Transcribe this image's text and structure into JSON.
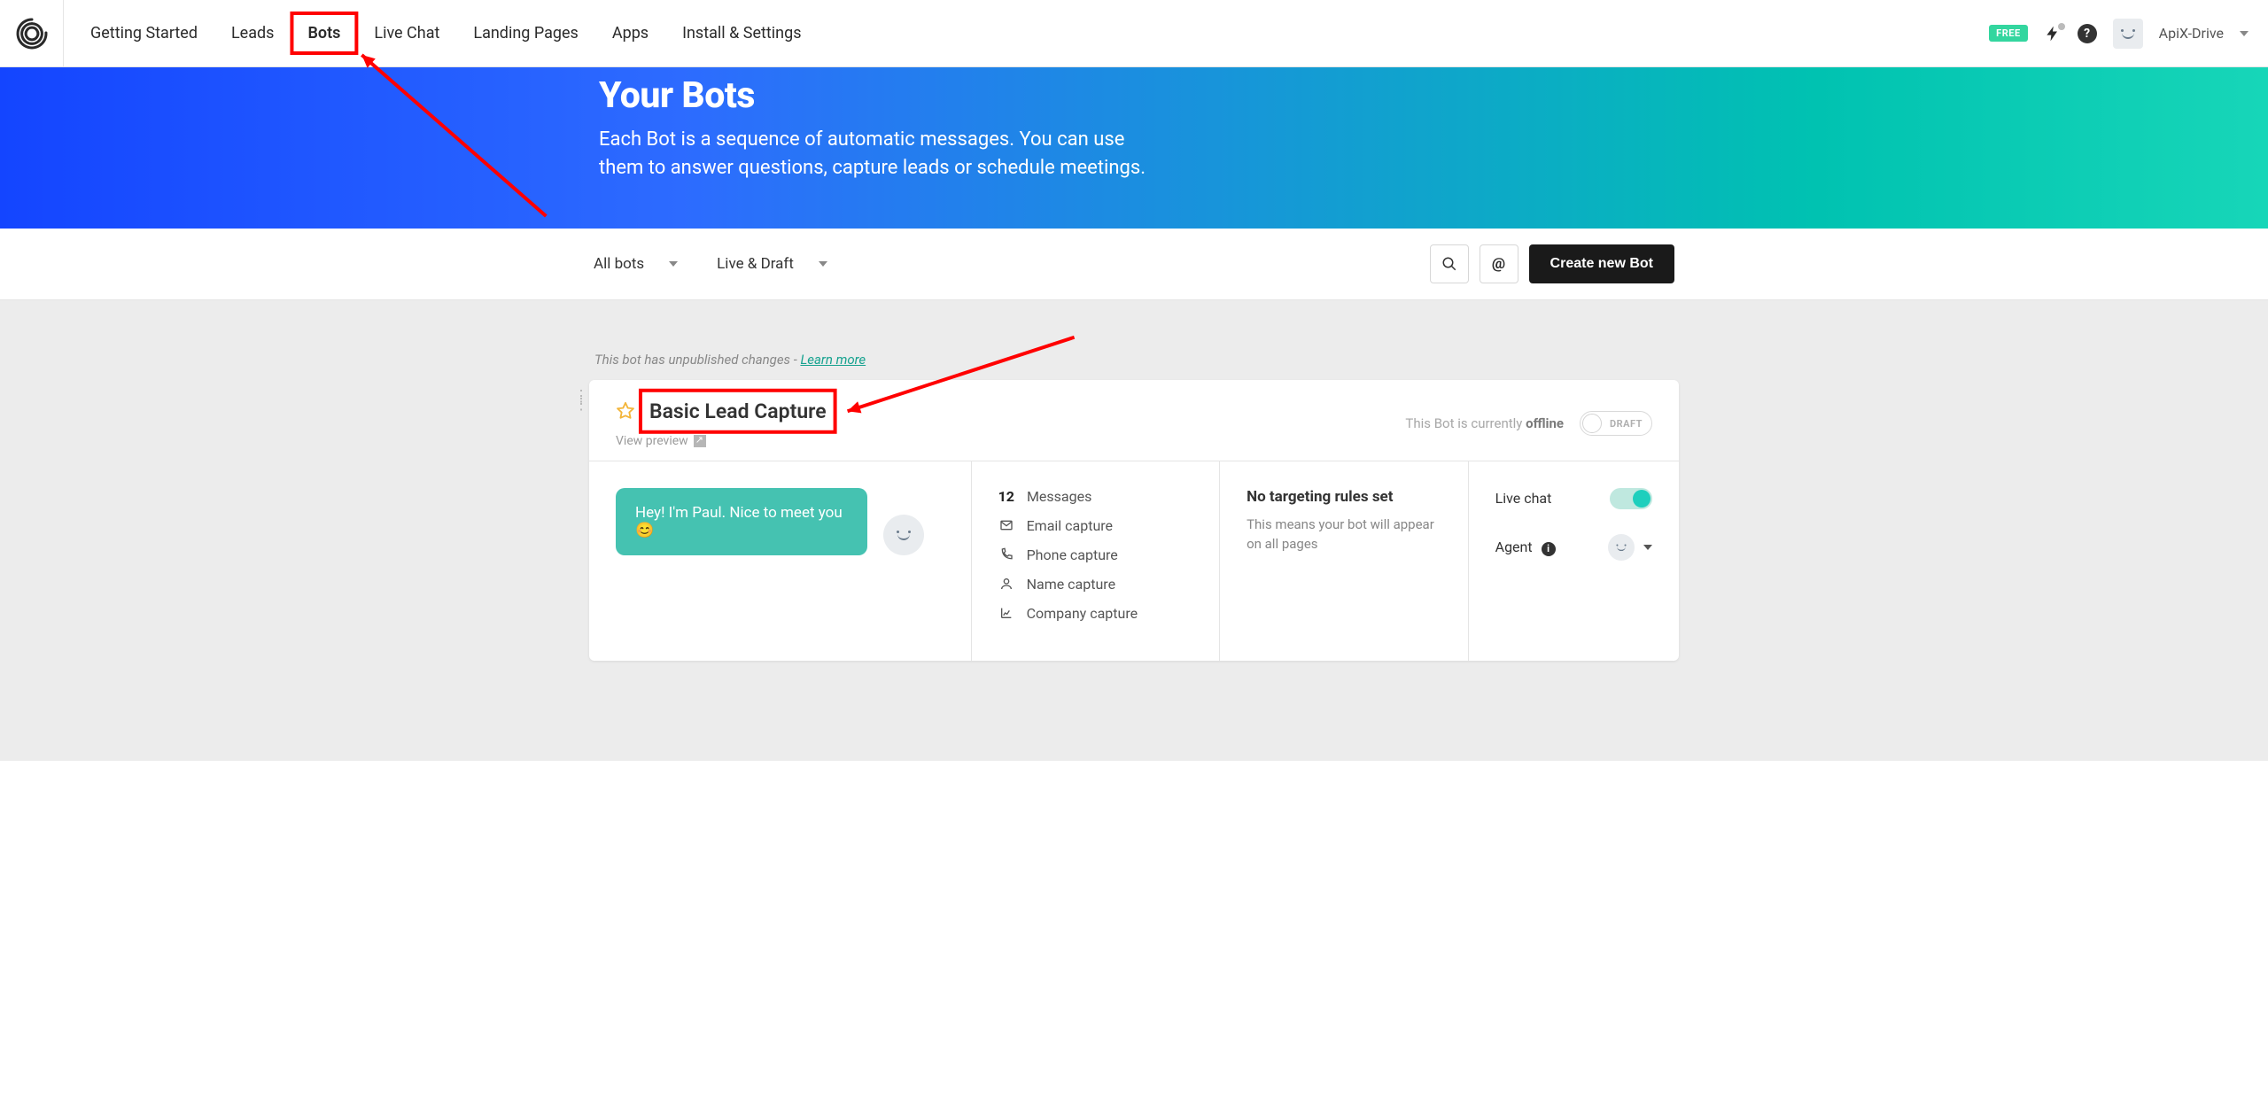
{
  "nav": {
    "items": [
      "Getting Started",
      "Leads",
      "Bots",
      "Live Chat",
      "Landing Pages",
      "Apps",
      "Install & Settings"
    ],
    "active_index": 2,
    "free_badge": "FREE",
    "user_name": "ApiX-Drive"
  },
  "hero": {
    "title": "Your Bots",
    "subtitle": "Each Bot is a sequence of automatic messages. You can use them to answer questions, capture leads or schedule meetings."
  },
  "toolbar": {
    "filter1": "All bots",
    "filter2": "Live & Draft",
    "create_label": "Create new Bot"
  },
  "notice": {
    "text": "This bot has unpublished changes - ",
    "link": "Learn more"
  },
  "bot": {
    "title": "Basic Lead Capture",
    "preview_label": "View preview",
    "status_prefix": "This Bot is currently ",
    "status_value": "offline",
    "toggle_label": "DRAFT",
    "bubble_text": "Hey! I'm Paul. Nice to meet you 😊",
    "stats": {
      "messages_count": "12",
      "messages_label": "Messages",
      "email": "Email capture",
      "phone": "Phone capture",
      "name": "Name capture",
      "company": "Company capture"
    },
    "targeting": {
      "title": "No targeting rules set",
      "body": "This means your bot will appear on all pages"
    },
    "settings": {
      "live_chat_label": "Live chat",
      "agent_label": "Agent"
    }
  }
}
